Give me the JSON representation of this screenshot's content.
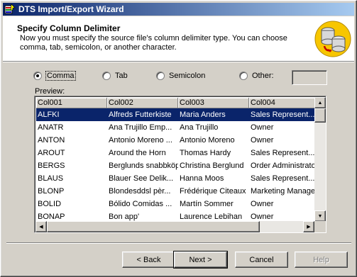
{
  "window": {
    "title": "DTS Import/Export Wizard"
  },
  "header": {
    "heading": "Specify Column Delimiter",
    "description": "Now you must specify the source file's column delimiter type.  You can choose comma, tab, semicolon, or another character."
  },
  "delimiters": {
    "comma": "Comma",
    "tab": "Tab",
    "semicolon": "Semicolon",
    "other": "Other:",
    "selected": "comma",
    "other_value": ""
  },
  "preview": {
    "label": "Preview:",
    "columns": [
      "Col001",
      "Col002",
      "Col003",
      "Col004"
    ],
    "rows": [
      [
        "ALFKI",
        "Alfreds Futterkiste",
        "Maria Anders",
        "Sales Represent..."
      ],
      [
        "ANATR",
        "Ana Trujillo Emp...",
        "Ana Trujillo",
        "Owner"
      ],
      [
        "ANTON",
        "Antonio Moreno ...",
        "Antonio Moreno",
        "Owner"
      ],
      [
        "AROUT",
        "Around the Horn",
        "Thomas Hardy",
        "Sales Represent..."
      ],
      [
        "BERGS",
        "Berglunds snabbköp",
        "Christina Berglund",
        "Order Administrator"
      ],
      [
        "BLAUS",
        "Blauer See Delik...",
        "Hanna Moos",
        "Sales Represent..."
      ],
      [
        "BLONP",
        "Blondesddsl pèr...",
        "Frédérique Citeaux",
        "Marketing Manager"
      ],
      [
        "BOLID",
        "Bólido Comidas ...",
        "Martín Sommer",
        "Owner"
      ],
      [
        "BONAP",
        "Bon app'",
        "Laurence Lebihan",
        "Owner"
      ]
    ],
    "selected_row": 0
  },
  "buttons": {
    "back": "< Back",
    "next": "Next >",
    "cancel": "Cancel",
    "help": "Help"
  },
  "colors": {
    "title_start": "#0a246a",
    "title_end": "#a6caf0",
    "selection": "#0a246a",
    "face": "#d4d0c8"
  }
}
